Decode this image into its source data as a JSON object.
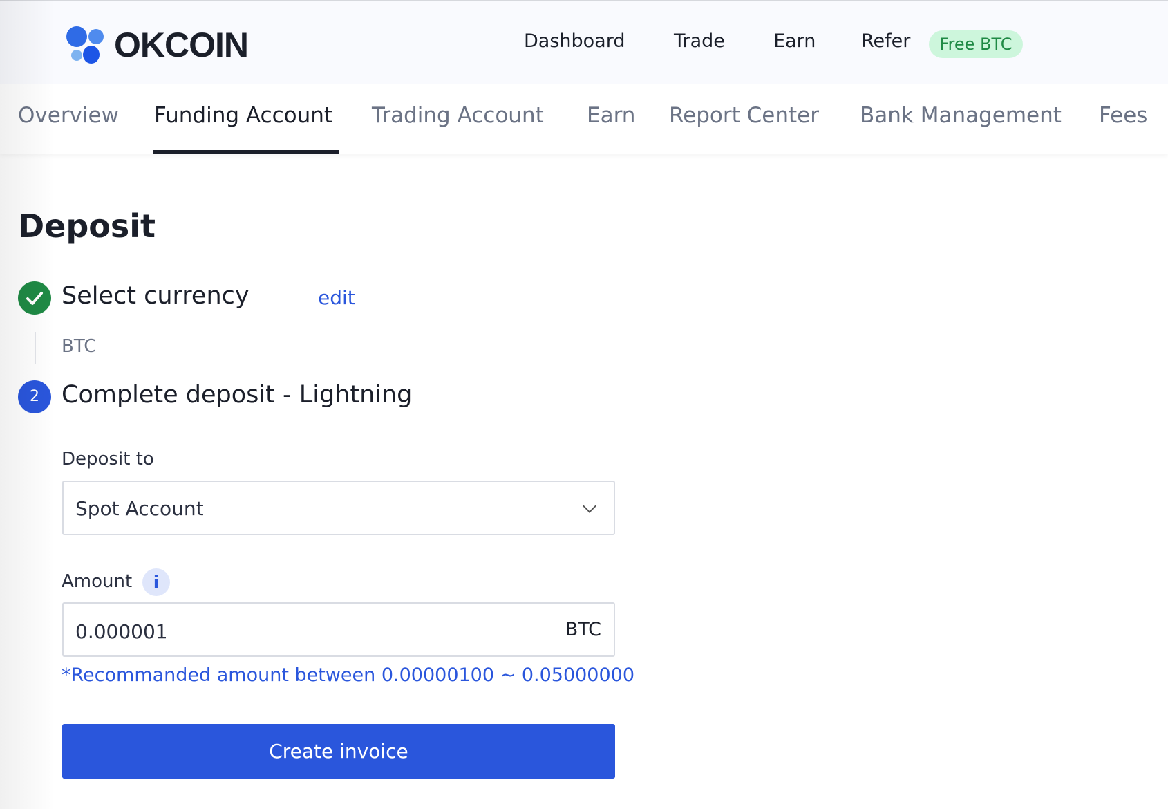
{
  "brand": {
    "name": "OKCOIN",
    "colors": {
      "dot1": "#2f6be6",
      "dot2": "#4f8bee",
      "dot3": "#7eb3f0",
      "dot4": "#1d55e6"
    }
  },
  "nav": {
    "items": [
      "Dashboard",
      "Trade",
      "Earn",
      "Refer"
    ],
    "badge": "Free BTC"
  },
  "tabs": {
    "items": [
      "Overview",
      "Funding Account",
      "Trading Account",
      "Earn",
      "Report Center",
      "Bank Management",
      "Fees"
    ],
    "active": "Funding Account"
  },
  "page": {
    "title": "Deposit"
  },
  "step1": {
    "number_icon": "check-icon",
    "title": "Select currency",
    "edit": "edit",
    "value": "BTC",
    "status_color": "#1f8a45"
  },
  "step2": {
    "number": "2",
    "title": "Complete deposit - Lightning",
    "color": "#2a56dc"
  },
  "form": {
    "deposit_to_label": "Deposit to",
    "deposit_to_value": "Spot Account",
    "amount_label": "Amount",
    "info_icon": "i",
    "amount_value": "0.000001",
    "amount_unit": "BTC",
    "hint": "*Recommanded amount between 0.00000100 ~ 0.05000000",
    "submit": "Create invoice"
  }
}
